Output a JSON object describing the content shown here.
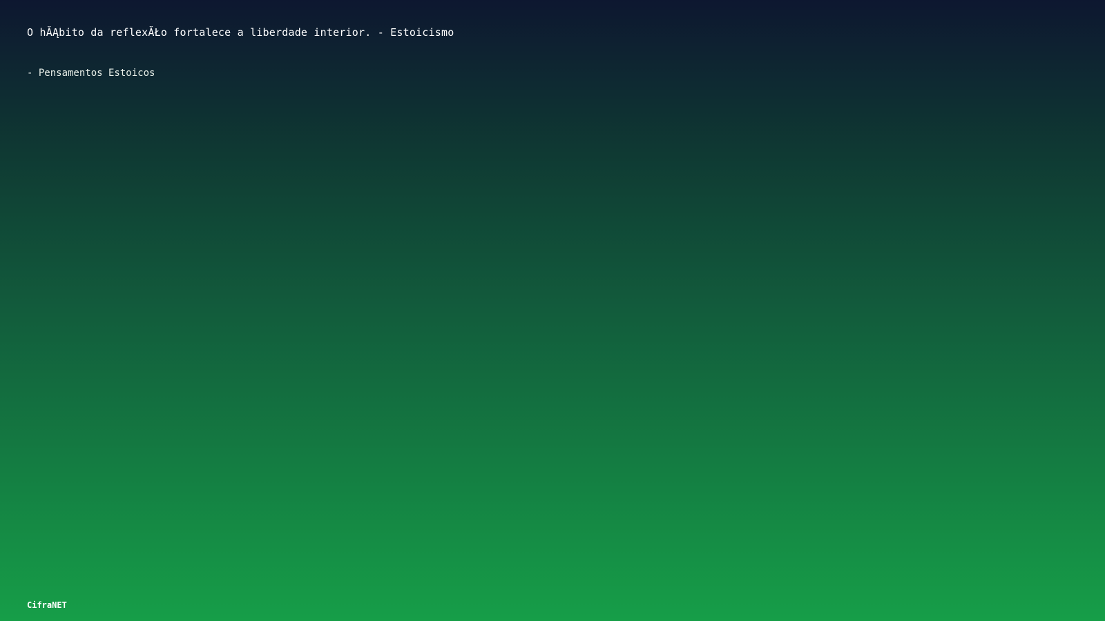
{
  "quote": {
    "text": "O hĂĄbito da reflexĂŁo fortalece a liberdade interior. - Estoicismo"
  },
  "author": {
    "text": "- Pensamentos Estoicos"
  },
  "brand": {
    "text": "CifraNET"
  },
  "colors": {
    "gradient_top": "#0d1730",
    "gradient_bottom": "#169e48",
    "text": "#ffffff"
  }
}
